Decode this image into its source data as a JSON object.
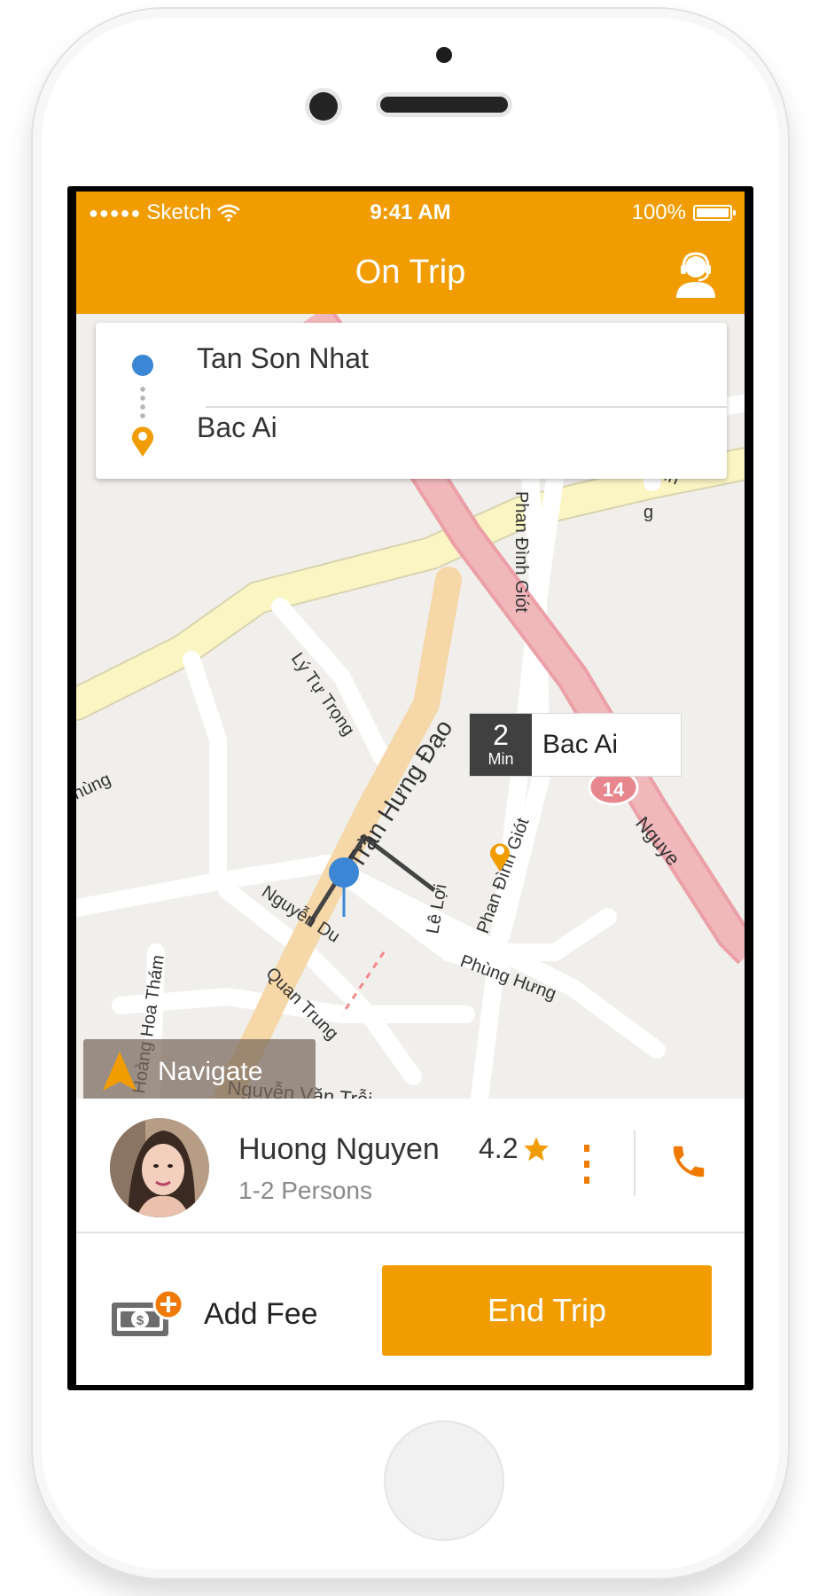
{
  "status_bar": {
    "carrier": "Sketch",
    "time": "9:41 AM",
    "battery": "100%"
  },
  "header": {
    "title": "On Trip",
    "support_icon": "support-agent-icon"
  },
  "route": {
    "origin": "Tan Son Nhat",
    "destination": "Bac Ai"
  },
  "map": {
    "eta_value": "2",
    "eta_unit": "Min",
    "eta_destination": "Bac Ai",
    "highway_shield": "14",
    "street_labels": {
      "tran_hung_dao": "Trần Hưng Đạo",
      "ly_tu_trong": "Lý Tự Trọng",
      "phan_dinh_giot_1": "Phan Đình Giót",
      "phan_dinh_giot_2": "Phan Đình Giót",
      "mac_dinh": "Mạc Đĩn",
      "nguyen_du": "Nguyễn Du",
      "le_loi": "Lê Lợi",
      "phung_hung": "Phùng Hưng",
      "quan_trung": "Quan Trung",
      "hong_hoa_tham": "Hoàng Hoa Thám",
      "nguyen_van_troi": "Nguyễn Văn Trỗi",
      "nguye": "Nguye",
      "hung": "hùng",
      "g_edge": "g"
    }
  },
  "navigate_button": {
    "label": "Navigate"
  },
  "driver": {
    "name": "Huong Nguyen",
    "subtitle": "1-2 Persons",
    "rating": "4.2"
  },
  "actions": {
    "add_fee_label": "Add Fee",
    "end_trip_label": "End Trip"
  },
  "colors": {
    "accent": "#f19c00",
    "origin_blue": "#3b87d6",
    "highway_pink": "#eaa0a6"
  }
}
